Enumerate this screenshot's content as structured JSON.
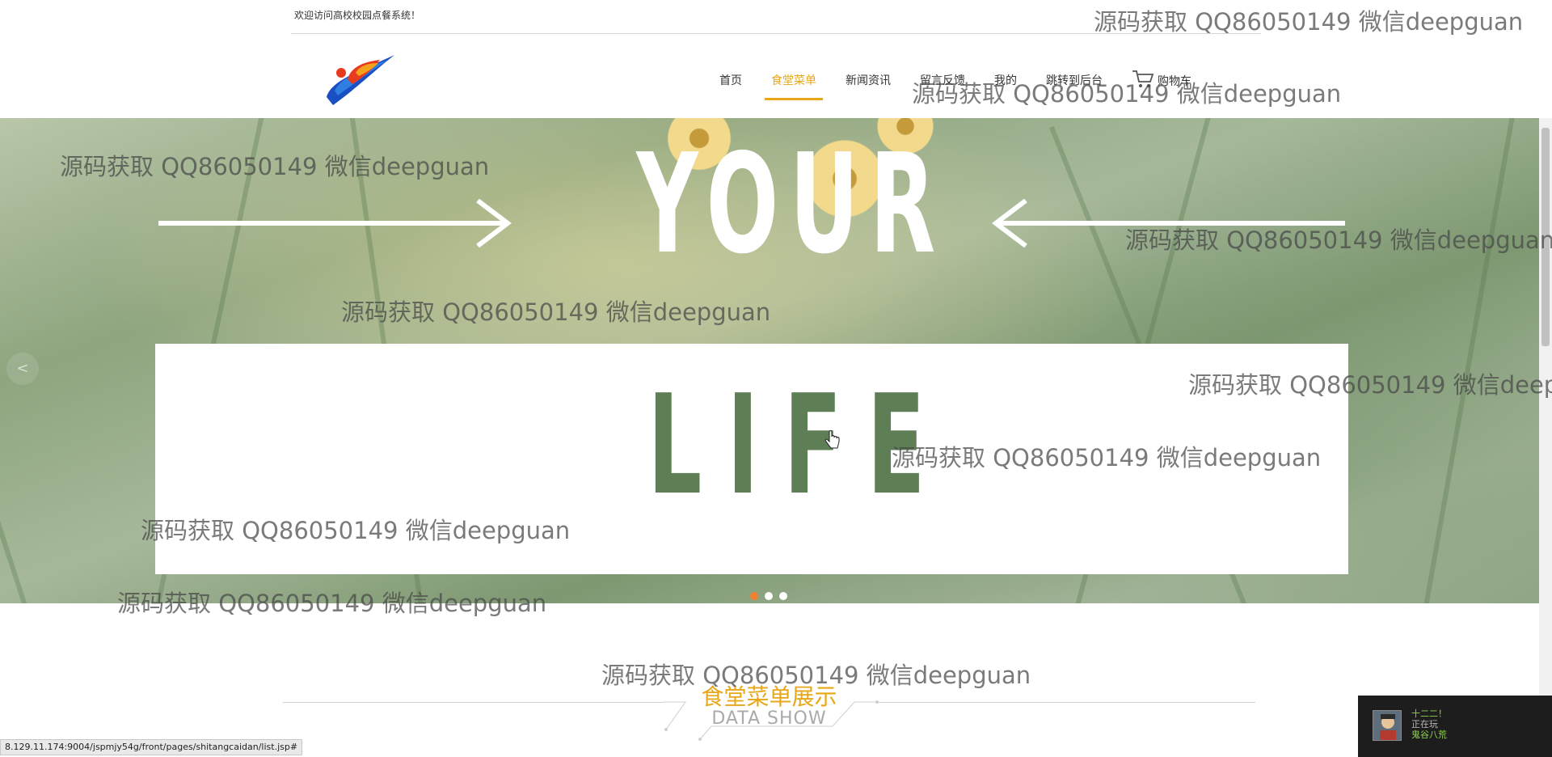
{
  "topbar": {
    "welcome": "欢迎访问高校校园点餐系统！"
  },
  "nav": {
    "items": [
      {
        "label": "首页",
        "active": false
      },
      {
        "label": "食堂菜单",
        "active": true
      },
      {
        "label": "新闻资讯",
        "active": false
      },
      {
        "label": "留言反馈",
        "active": false
      },
      {
        "label": "我的",
        "active": false
      },
      {
        "label": "跳转到后台",
        "active": false
      }
    ],
    "cart_label": "购物车"
  },
  "banner": {
    "headline_top": "YOUR",
    "headline_bottom": "LIFE",
    "prev_label": "<",
    "slide_count": 3,
    "active_slide": 1
  },
  "section": {
    "title_cn": "食堂菜单展示",
    "title_en": "DATA SHOW"
  },
  "watermark_text": "源码获取 QQ86050149 微信deepguan",
  "statusbar": {
    "url": "8.129.11.174:9004/jspmjy54g/front/pages/shitangcaidan/list.jsp#"
  },
  "popup": {
    "line1": "十二二！",
    "line2": "正在玩",
    "line3": "鬼谷八荒"
  },
  "colors": {
    "accent": "#e8a718",
    "active_dot": "#f08030",
    "popup_bg": "#1d1d1d"
  },
  "icons": {
    "cart": "cart-icon",
    "logo": "logo-icon",
    "prev": "chevron-left-icon",
    "pointer": "hand-cursor-icon"
  }
}
